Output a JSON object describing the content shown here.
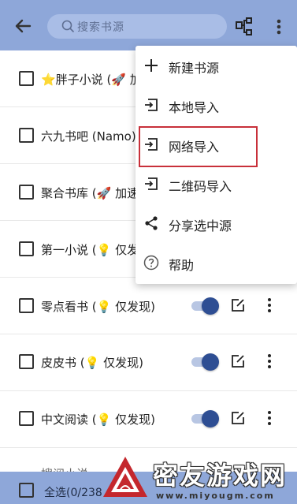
{
  "header": {
    "search_placeholder": "搜索书源",
    "back_icon": "arrow-back-icon",
    "group_icon": "tree-structure-icon",
    "more_icon": "more-vert-icon"
  },
  "sources": [
    {
      "name": "⭐胖子小说 (🚀 加"
    },
    {
      "name": "六九书吧 (Namo)"
    },
    {
      "name": "聚合书库 (🚀 加速,"
    },
    {
      "name": "第一小说 (💡 仅发现"
    },
    {
      "name": "零点看书 (💡 仅发现)"
    },
    {
      "name": "皮皮书 (💡 仅发现)"
    },
    {
      "name": "中文阅读 (💡 仅发现)"
    },
    {
      "name": "搜阅小说"
    }
  ],
  "menu": {
    "items": [
      {
        "label": "新建书源",
        "icon": "add-icon"
      },
      {
        "label": "本地导入",
        "icon": "import-icon"
      },
      {
        "label": "网络导入",
        "icon": "import-icon"
      },
      {
        "label": "二维码导入",
        "icon": "import-icon"
      },
      {
        "label": "分享选中源",
        "icon": "share-icon"
      },
      {
        "label": "帮助",
        "icon": "help-icon"
      }
    ],
    "highlighted": "网络导入"
  },
  "footer": {
    "select_all_label": "全选(0/238"
  },
  "watermark": {
    "title": "密友游戏网",
    "url": "www.miyougm.com"
  },
  "colors": {
    "bar": "#8ea7d9",
    "toggle_on": "#2e4e93",
    "highlight": "#c8303a"
  }
}
